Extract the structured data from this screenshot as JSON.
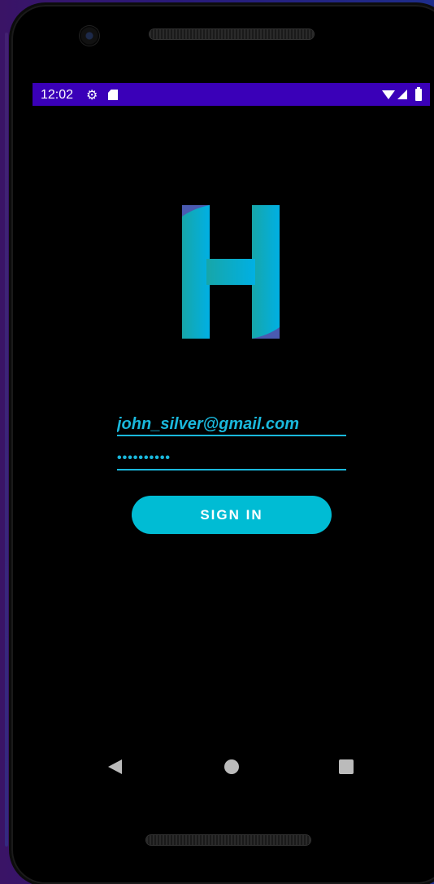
{
  "status_bar": {
    "time": "12:02",
    "icons": [
      "gear-icon",
      "sd-card-icon",
      "wifi-icon",
      "signal-icon",
      "battery-icon"
    ],
    "background_color": "#3a00b8"
  },
  "logo": {
    "letter": "H",
    "gradient": [
      "#1aa8a8",
      "#00aedc"
    ],
    "accent": "#4a5ab0"
  },
  "form": {
    "email_value": "john_silver@gmail.com",
    "password_value": "••••••••••",
    "accent_color": "#1ab8dc"
  },
  "actions": {
    "signin_label": "SIGN IN",
    "button_color": "#00bcd4"
  },
  "nav_bar": {
    "icons": [
      "back-icon",
      "home-icon",
      "recents-icon"
    ]
  }
}
